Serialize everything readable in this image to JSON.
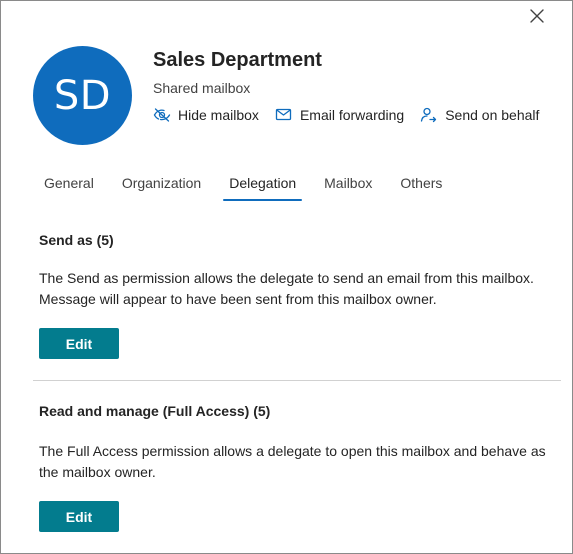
{
  "header": {
    "avatar_initials": "SD",
    "title": "Sales Department",
    "subtitle": "Shared mailbox",
    "actions": [
      {
        "label": "Hide mailbox",
        "icon": "eye-hide-icon"
      },
      {
        "label": "Email forwarding",
        "icon": "mail-forward-icon"
      },
      {
        "label": "Send on behalf",
        "icon": "person-send-icon"
      }
    ],
    "avatar_color": "#0f6cbd"
  },
  "tabs": [
    {
      "label": "General",
      "active": false
    },
    {
      "label": "Organization",
      "active": false
    },
    {
      "label": "Delegation",
      "active": true
    },
    {
      "label": "Mailbox",
      "active": false
    },
    {
      "label": "Others",
      "active": false
    }
  ],
  "sections": [
    {
      "title": "Send as (5)",
      "description": "The Send as permission allows the delegate to send an email from this mailbox. Message will appear to have been sent from this mailbox owner.",
      "button_label": "Edit"
    },
    {
      "title": "Read and manage (Full Access) (5)",
      "description": "The Full Access permission allows a delegate to open this mailbox and behave as the mailbox owner.",
      "button_label": "Edit"
    }
  ],
  "colors": {
    "accent": "#0f6cbd",
    "button": "#037c8e"
  }
}
